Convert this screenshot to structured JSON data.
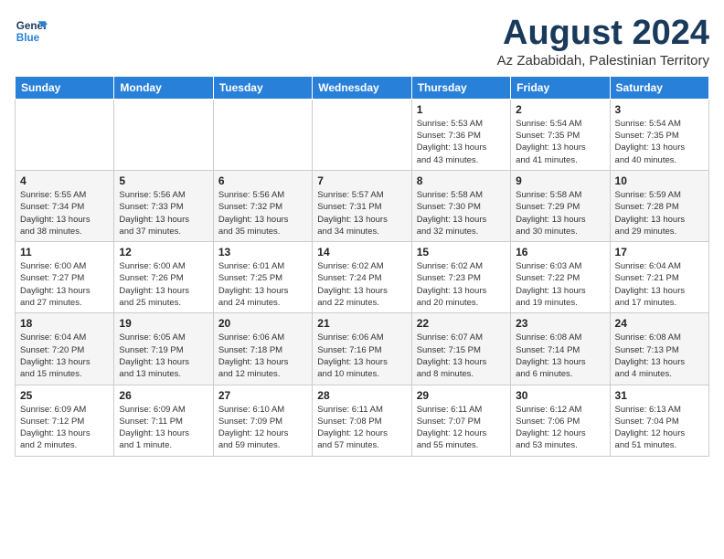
{
  "header": {
    "logo_line1": "General",
    "logo_line2": "Blue",
    "month_year": "August 2024",
    "location": "Az Zababidah, Palestinian Territory"
  },
  "weekdays": [
    "Sunday",
    "Monday",
    "Tuesday",
    "Wednesday",
    "Thursday",
    "Friday",
    "Saturday"
  ],
  "weeks": [
    [
      {
        "day": "",
        "info": ""
      },
      {
        "day": "",
        "info": ""
      },
      {
        "day": "",
        "info": ""
      },
      {
        "day": "",
        "info": ""
      },
      {
        "day": "1",
        "info": "Sunrise: 5:53 AM\nSunset: 7:36 PM\nDaylight: 13 hours\nand 43 minutes."
      },
      {
        "day": "2",
        "info": "Sunrise: 5:54 AM\nSunset: 7:35 PM\nDaylight: 13 hours\nand 41 minutes."
      },
      {
        "day": "3",
        "info": "Sunrise: 5:54 AM\nSunset: 7:35 PM\nDaylight: 13 hours\nand 40 minutes."
      }
    ],
    [
      {
        "day": "4",
        "info": "Sunrise: 5:55 AM\nSunset: 7:34 PM\nDaylight: 13 hours\nand 38 minutes."
      },
      {
        "day": "5",
        "info": "Sunrise: 5:56 AM\nSunset: 7:33 PM\nDaylight: 13 hours\nand 37 minutes."
      },
      {
        "day": "6",
        "info": "Sunrise: 5:56 AM\nSunset: 7:32 PM\nDaylight: 13 hours\nand 35 minutes."
      },
      {
        "day": "7",
        "info": "Sunrise: 5:57 AM\nSunset: 7:31 PM\nDaylight: 13 hours\nand 34 minutes."
      },
      {
        "day": "8",
        "info": "Sunrise: 5:58 AM\nSunset: 7:30 PM\nDaylight: 13 hours\nand 32 minutes."
      },
      {
        "day": "9",
        "info": "Sunrise: 5:58 AM\nSunset: 7:29 PM\nDaylight: 13 hours\nand 30 minutes."
      },
      {
        "day": "10",
        "info": "Sunrise: 5:59 AM\nSunset: 7:28 PM\nDaylight: 13 hours\nand 29 minutes."
      }
    ],
    [
      {
        "day": "11",
        "info": "Sunrise: 6:00 AM\nSunset: 7:27 PM\nDaylight: 13 hours\nand 27 minutes."
      },
      {
        "day": "12",
        "info": "Sunrise: 6:00 AM\nSunset: 7:26 PM\nDaylight: 13 hours\nand 25 minutes."
      },
      {
        "day": "13",
        "info": "Sunrise: 6:01 AM\nSunset: 7:25 PM\nDaylight: 13 hours\nand 24 minutes."
      },
      {
        "day": "14",
        "info": "Sunrise: 6:02 AM\nSunset: 7:24 PM\nDaylight: 13 hours\nand 22 minutes."
      },
      {
        "day": "15",
        "info": "Sunrise: 6:02 AM\nSunset: 7:23 PM\nDaylight: 13 hours\nand 20 minutes."
      },
      {
        "day": "16",
        "info": "Sunrise: 6:03 AM\nSunset: 7:22 PM\nDaylight: 13 hours\nand 19 minutes."
      },
      {
        "day": "17",
        "info": "Sunrise: 6:04 AM\nSunset: 7:21 PM\nDaylight: 13 hours\nand 17 minutes."
      }
    ],
    [
      {
        "day": "18",
        "info": "Sunrise: 6:04 AM\nSunset: 7:20 PM\nDaylight: 13 hours\nand 15 minutes."
      },
      {
        "day": "19",
        "info": "Sunrise: 6:05 AM\nSunset: 7:19 PM\nDaylight: 13 hours\nand 13 minutes."
      },
      {
        "day": "20",
        "info": "Sunrise: 6:06 AM\nSunset: 7:18 PM\nDaylight: 13 hours\nand 12 minutes."
      },
      {
        "day": "21",
        "info": "Sunrise: 6:06 AM\nSunset: 7:16 PM\nDaylight: 13 hours\nand 10 minutes."
      },
      {
        "day": "22",
        "info": "Sunrise: 6:07 AM\nSunset: 7:15 PM\nDaylight: 13 hours\nand 8 minutes."
      },
      {
        "day": "23",
        "info": "Sunrise: 6:08 AM\nSunset: 7:14 PM\nDaylight: 13 hours\nand 6 minutes."
      },
      {
        "day": "24",
        "info": "Sunrise: 6:08 AM\nSunset: 7:13 PM\nDaylight: 13 hours\nand 4 minutes."
      }
    ],
    [
      {
        "day": "25",
        "info": "Sunrise: 6:09 AM\nSunset: 7:12 PM\nDaylight: 13 hours\nand 2 minutes."
      },
      {
        "day": "26",
        "info": "Sunrise: 6:09 AM\nSunset: 7:11 PM\nDaylight: 13 hours\nand 1 minute."
      },
      {
        "day": "27",
        "info": "Sunrise: 6:10 AM\nSunset: 7:09 PM\nDaylight: 12 hours\nand 59 minutes."
      },
      {
        "day": "28",
        "info": "Sunrise: 6:11 AM\nSunset: 7:08 PM\nDaylight: 12 hours\nand 57 minutes."
      },
      {
        "day": "29",
        "info": "Sunrise: 6:11 AM\nSunset: 7:07 PM\nDaylight: 12 hours\nand 55 minutes."
      },
      {
        "day": "30",
        "info": "Sunrise: 6:12 AM\nSunset: 7:06 PM\nDaylight: 12 hours\nand 53 minutes."
      },
      {
        "day": "31",
        "info": "Sunrise: 6:13 AM\nSunset: 7:04 PM\nDaylight: 12 hours\nand 51 minutes."
      }
    ]
  ]
}
